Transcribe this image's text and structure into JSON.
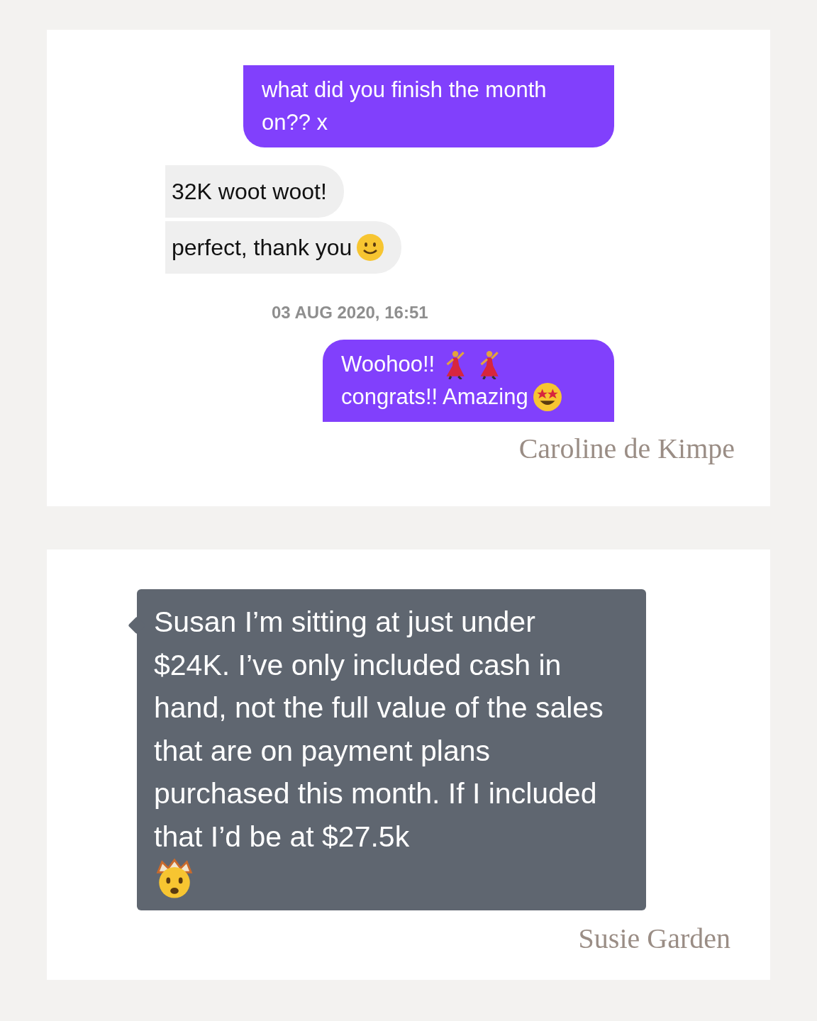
{
  "cards": [
    {
      "messages": [
        {
          "kind": "sent",
          "lines": [
            "what did you finish the month",
            "on?? x"
          ]
        },
        {
          "kind": "received",
          "lines": [
            "32K woot woot!"
          ]
        },
        {
          "kind": "received",
          "lines": [
            "perfect, thank you"
          ]
        },
        {
          "kind": "timestamp",
          "lines": [
            "03 AUG 2020, 16:51"
          ]
        },
        {
          "kind": "sent",
          "lines": [
            "Woohoo!!",
            "congrats!! Amazing"
          ]
        }
      ],
      "signature": "Caroline de Kimpe"
    },
    {
      "messages": [
        {
          "kind": "dark",
          "lines": [
            "Susan I’m sitting at just under $24K. I’ve only included cash in hand, not the full value of the sales that are on payment plans purchased this month. If I included that I’d be at $27.5k"
          ]
        }
      ],
      "signature": "Susie Garden"
    }
  ]
}
